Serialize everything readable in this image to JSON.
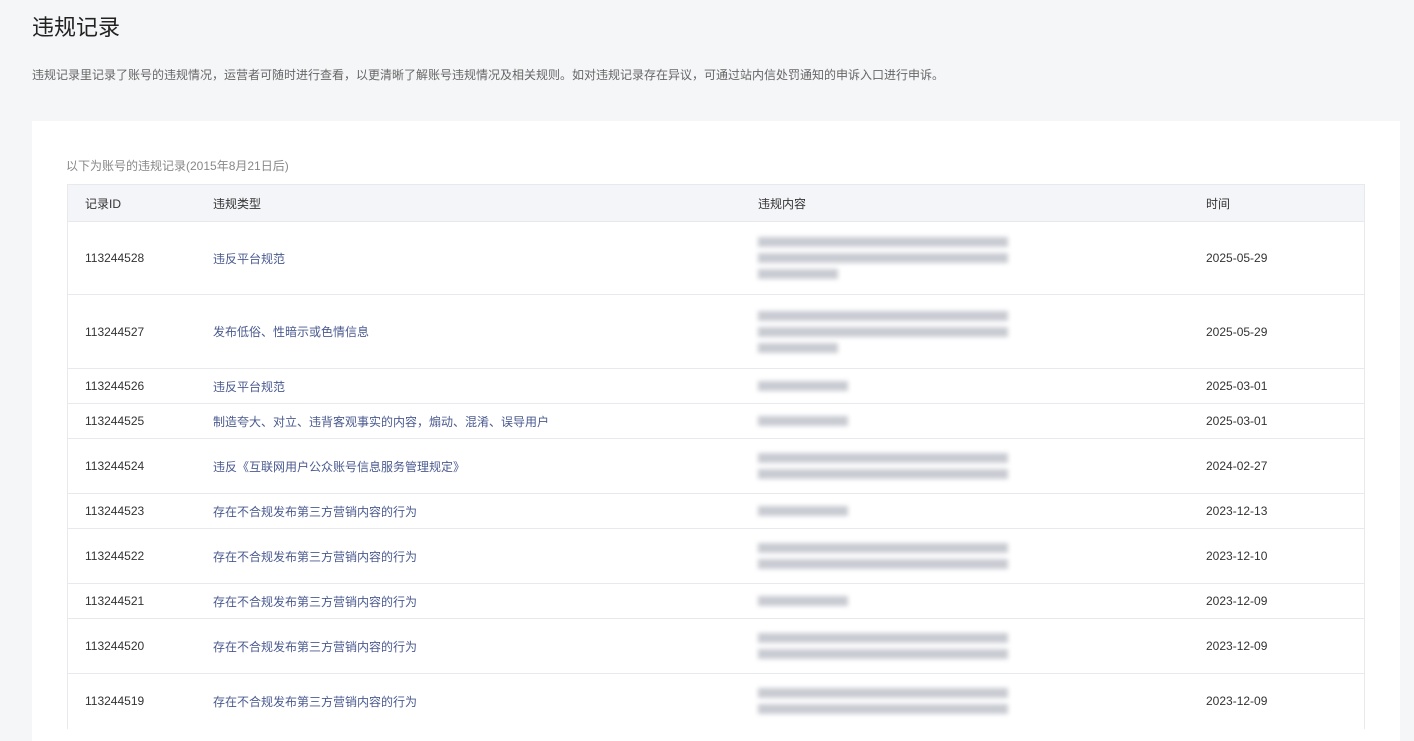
{
  "page": {
    "title": "违规记录",
    "description": "违规记录里记录了账号的违规情况，运营者可随时进行查看，以更清晰了解账号违规情况及相关规则。如对违规记录存在异议，可通过站内信处罚通知的申诉入口进行申诉。"
  },
  "card": {
    "subtitle": "以下为账号的违规记录(2015年8月21日后)"
  },
  "table": {
    "headers": [
      "记录ID",
      "违规类型",
      "违规内容",
      "时间"
    ],
    "rows": [
      {
        "id": "113244528",
        "type": "违反平台规范",
        "date": "2025-05-29",
        "lines": 3,
        "h": 73
      },
      {
        "id": "113244527",
        "type": "发布低俗、性暗示或色情信息",
        "date": "2025-05-29",
        "lines": 3,
        "h": 74
      },
      {
        "id": "113244526",
        "type": "违反平台规范",
        "date": "2025-03-01",
        "lines": 1,
        "h": 35
      },
      {
        "id": "113244525",
        "type": "制造夸大、对立、违背客观事实的内容，煽动、混淆、误导用户",
        "date": "2025-03-01",
        "lines": 1,
        "h": 35
      },
      {
        "id": "113244524",
        "type": "违反《互联网用户公众账号信息服务管理规定》",
        "date": "2024-02-27",
        "lines": 2,
        "h": 55
      },
      {
        "id": "113244523",
        "type": "存在不合规发布第三方营销内容的行为",
        "date": "2023-12-13",
        "lines": 1,
        "h": 35
      },
      {
        "id": "113244522",
        "type": "存在不合规发布第三方营销内容的行为",
        "date": "2023-12-10",
        "lines": 2,
        "h": 55
      },
      {
        "id": "113244521",
        "type": "存在不合规发布第三方营销内容的行为",
        "date": "2023-12-09",
        "lines": 1,
        "h": 35
      },
      {
        "id": "113244520",
        "type": "存在不合规发布第三方营销内容的行为",
        "date": "2023-12-09",
        "lines": 2,
        "h": 55
      },
      {
        "id": "113244519",
        "type": "存在不合规发布第三方营销内容的行为",
        "date": "2023-12-09",
        "lines": 2,
        "h": 55
      }
    ]
  }
}
